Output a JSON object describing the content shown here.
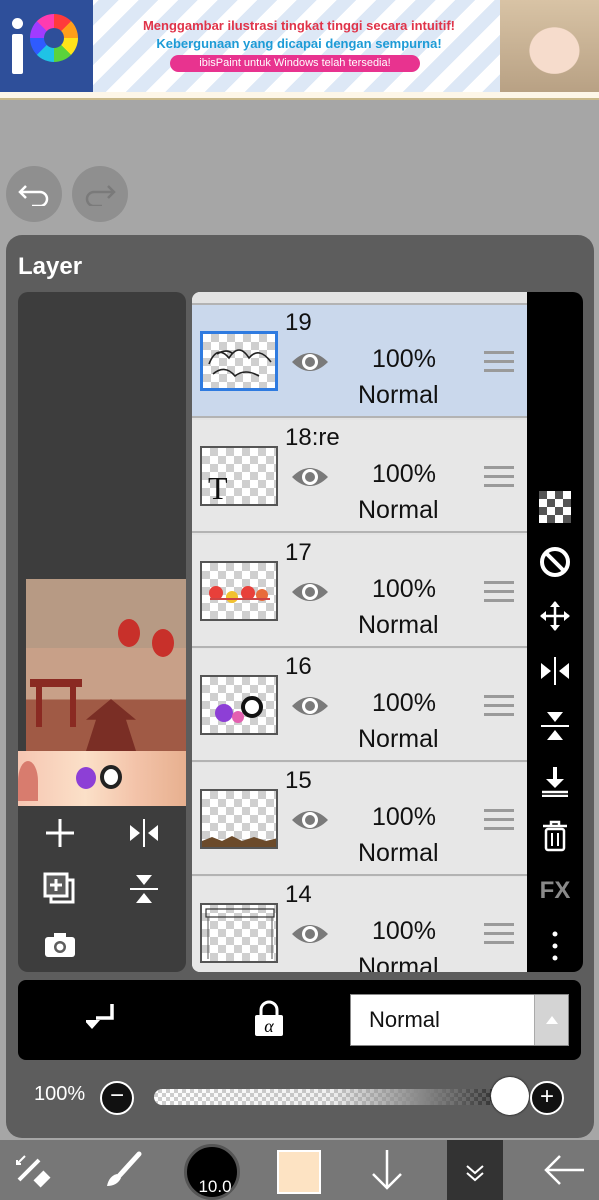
{
  "ad": {
    "line1": "Menggambar ilustrasi tingkat tinggi secara intuitif!",
    "line2": "Kebergunaan yang dicapai dengan sempurna!",
    "pill": "ibisPaint untuk Windows telah tersedia!"
  },
  "panel": {
    "title": "Layer"
  },
  "layers": [
    {
      "name": "19",
      "opacity": "100%",
      "mode": "Normal",
      "selected": true,
      "thumb": "sketch"
    },
    {
      "name": "18:re",
      "opacity": "100%",
      "mode": "Normal",
      "selected": false,
      "thumb": "text"
    },
    {
      "name": "17",
      "opacity": "100%",
      "mode": "Normal",
      "selected": false,
      "thumb": "fans"
    },
    {
      "name": "16",
      "opacity": "100%",
      "mode": "Normal",
      "selected": false,
      "thumb": "chibi"
    },
    {
      "name": "15",
      "opacity": "100%",
      "mode": "Normal",
      "selected": false,
      "thumb": "ground"
    },
    {
      "name": "14",
      "opacity": "100%",
      "mode": "Normal",
      "selected": false,
      "thumb": "frame"
    }
  ],
  "thumb_text_glyph": "T",
  "right_toolbar": {
    "fx_label": "FX"
  },
  "blend": {
    "mode_value": "Normal"
  },
  "opacity_slider": {
    "label": "100%",
    "value_fraction": 1.0
  },
  "brush": {
    "size_label": "10.0"
  },
  "colors": {
    "current_color": "#fde3c3",
    "selected_layer_bg": "#cad8ec",
    "selection_border": "#2f7be0"
  }
}
